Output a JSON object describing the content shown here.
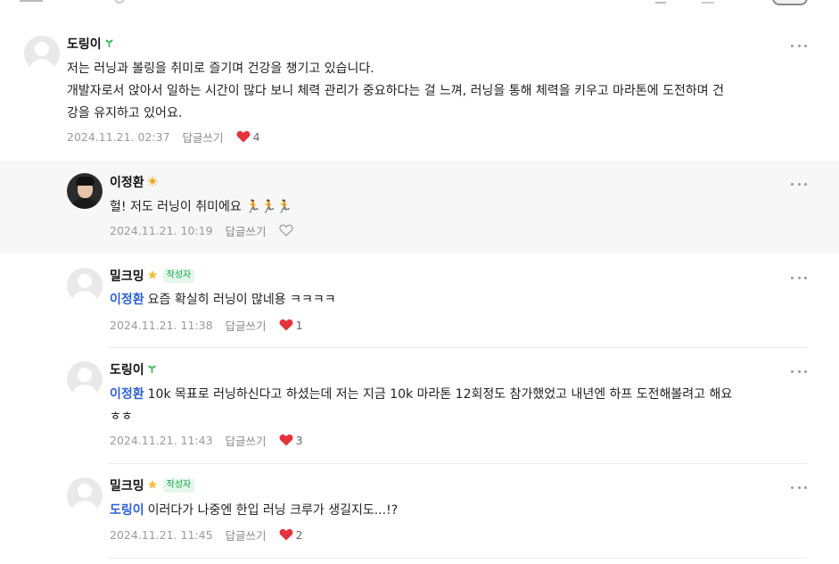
{
  "comments": [
    {
      "name": "도링이",
      "badge": "sprout",
      "lines": [
        "저는 러닝과 볼링을 취미로 즐기며 건강을 챙기고 있습니다.",
        "개발자로서 앉아서 일하는 시간이 많다 보니 체력 관리가 중요하다는 걸 느껴, 러닝을 통해 체력을 키우고 마라톤에 도전하며 건",
        "강을 유지하고 있어요."
      ],
      "date": "2024.11.21. 02:37",
      "reply_label": "답글쓰기",
      "likes": "4",
      "liked": true
    },
    {
      "name": "이정환",
      "badge": "sun",
      "text": "헐! 저도 러닝이 취미에요 🏃🏃🏃",
      "date": "2024.11.21. 10:19",
      "reply_label": "답글쓰기",
      "liked": false
    },
    {
      "name": "밀크밍",
      "badge": "star",
      "author_label": "작성자",
      "mention": "이정환",
      "text": "요즘 확실히 러닝이 많네용 ㅋㅋㅋㅋ",
      "date": "2024.11.21. 11:38",
      "reply_label": "답글쓰기",
      "likes": "1",
      "liked": true
    },
    {
      "name": "도링이",
      "badge": "sprout",
      "mention": "이정환",
      "text": "10k 목표로 러닝하신다고 하셨는데 저는 지금 10k 마라톤 12회정도 참가했었고 내년엔 하프 도전해볼려고 해요",
      "text2": "ㅎㅎ",
      "date": "2024.11.21. 11:43",
      "reply_label": "답글쓰기",
      "likes": "3",
      "liked": true
    },
    {
      "name": "밀크밍",
      "badge": "star",
      "author_label": "작성자",
      "mention": "도링이",
      "text": "이러다가 나중엔 한입 러닝 크루가 생길지도...!?",
      "date": "2024.11.21. 11:45",
      "reply_label": "답글쓰기",
      "likes": "2",
      "liked": true
    }
  ],
  "colors": {
    "mention": "#2d5fd8",
    "heart": "#e5323b",
    "author_badge": "#18a34a",
    "highlight_bg": "#f7f7f7"
  },
  "icons": {
    "more": "more-dots-icon",
    "heart_filled": "heart-filled-icon",
    "heart_outline": "heart-outline-icon",
    "sprout": "sprout-icon",
    "sun": "sun-icon",
    "star": "star-icon"
  }
}
